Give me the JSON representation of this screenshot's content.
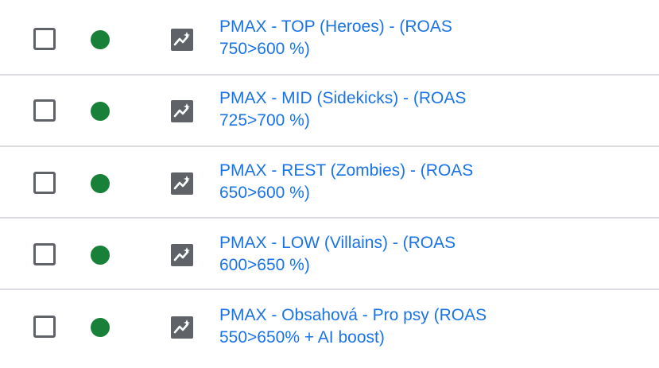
{
  "campaigns": [
    {
      "name": "PMAX - TOP (Heroes) - (ROAS 750>600 %)",
      "status": "enabled",
      "type_icon": "performance-max-icon"
    },
    {
      "name": "PMAX - MID (Sidekicks) - (ROAS 725>700 %)",
      "status": "enabled",
      "type_icon": "performance-max-icon"
    },
    {
      "name": "PMAX - REST (Zombies) - (ROAS 650>600 %)",
      "status": "enabled",
      "type_icon": "performance-max-icon"
    },
    {
      "name": "PMAX - LOW (Villains) - (ROAS 600>650 %)",
      "status": "enabled",
      "type_icon": "performance-max-icon"
    },
    {
      "name": "PMAX - Obsahová - Pro psy (ROAS 550>650% + AI boost)",
      "status": "enabled",
      "type_icon": "performance-max-icon"
    }
  ],
  "colors": {
    "link": "#1a73e8",
    "status_enabled": "#188038",
    "checkbox_border": "#5f6368",
    "icon_bg": "#5f6368",
    "divider": "#dadce0"
  }
}
